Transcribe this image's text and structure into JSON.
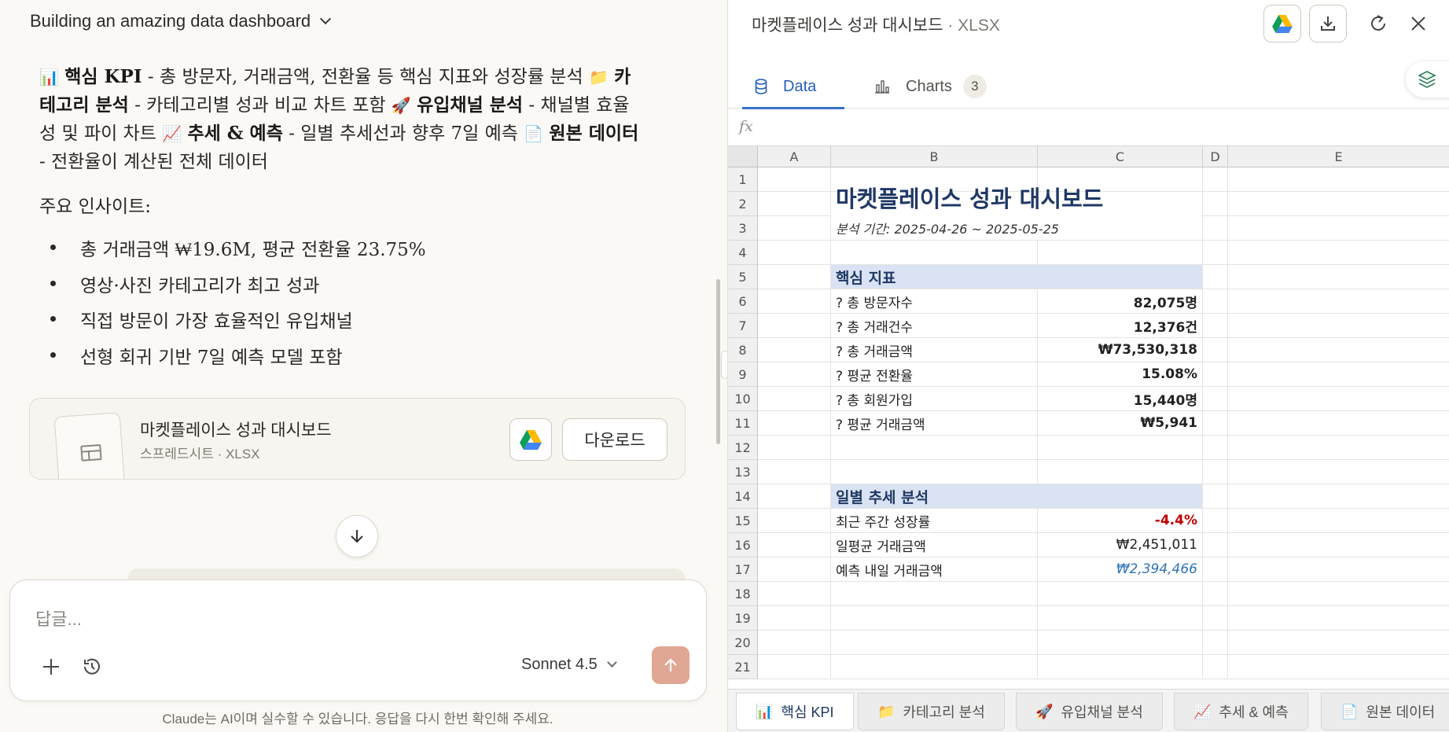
{
  "conversation": {
    "title": "Building an amazing data dashboard"
  },
  "message": {
    "parts": [
      {
        "emoji": "📊",
        "bold": "핵심 KPI",
        "text": " - 총 방문자, 거래금액, 전환율 등 핵심 지표와 성장률 분석 "
      },
      {
        "emoji": "📁",
        "bold": "카테고리 분석",
        "text": " - 카테고리별 성과 비교 차트 포함 "
      },
      {
        "emoji": "🚀",
        "bold": "유입채널 분석",
        "text": " - 채널별 효율성 및 파이 차트 "
      },
      {
        "emoji": "📈",
        "bold": "추세 & 예측",
        "text": " - 일별 추세선과 향후 7일 예측 "
      },
      {
        "emoji": "📄",
        "bold": "원본 데이터",
        "text": " - 전환율이 계산된 전체 데이터"
      }
    ],
    "insights_heading": "주요 인사이트:",
    "insights": [
      "총 거래금액 ₩19.6M, 평균 전환율 23.75%",
      "영상·사진 카테고리가 최고 성과",
      "직접 방문이 가장 효율적인 유입채널",
      "선형 회귀 기반 7일 예측 모델 포함"
    ]
  },
  "artifact": {
    "title": "마켓플레이스 성과 대시보드",
    "subtitle": "스프레드시트 · XLSX",
    "download_label": "다운로드"
  },
  "composer": {
    "placeholder": "답글...",
    "model": "Sonnet 4.5"
  },
  "disclaimer": "Claude는 AI이며 실수할 수 있습니다. 응답을 다시 한번 확인해 주세요.",
  "viewer": {
    "title": "마켓플레이스 성과 대시보드",
    "file_type": " · XLSX",
    "tabs": [
      {
        "label": "Data",
        "icon": "database-icon",
        "active": true
      },
      {
        "label": "Charts",
        "icon": "bar-chart-icon",
        "count": "3",
        "active": false
      }
    ],
    "formula_label": "fx"
  },
  "sheet": {
    "columns": [
      "A",
      "B",
      "C",
      "D",
      "E"
    ],
    "rows": [
      "1",
      "2",
      "3",
      "4",
      "5",
      "6",
      "7",
      "8",
      "9",
      "10",
      "11",
      "12",
      "13",
      "14",
      "15",
      "16",
      "17",
      "18",
      "19",
      "20",
      "21"
    ],
    "title": "마켓플레이스 성과 대시보드",
    "period": "분석 기간: 2025-04-26 ~ 2025-05-25",
    "kpi_section": "핵심 지표",
    "kpis": [
      {
        "label": "? 총 방문자수",
        "value": "82,075명"
      },
      {
        "label": "? 총 거래건수",
        "value": "12,376건"
      },
      {
        "label": "? 총 거래금액",
        "value": "₩73,530,318"
      },
      {
        "label": "? 평균 전환율",
        "value": "15.08%"
      },
      {
        "label": "? 총 회원가입",
        "value": "15,440명"
      },
      {
        "label": "? 평균 거래금액",
        "value": "₩5,941"
      }
    ],
    "trend_section": "일별 추세 분석",
    "trend": [
      {
        "label": "최근 주간 성장률",
        "value": "-4.4%"
      },
      {
        "label": "일평균 거래금액",
        "value": "₩2,451,011"
      },
      {
        "label": "예측 내일 거래금액",
        "value": "₩2,394,466"
      }
    ]
  },
  "sheet_tabs": [
    {
      "emoji": "📊",
      "label": "핵심 KPI",
      "active": true
    },
    {
      "emoji": "📁",
      "label": "카테고리 분석",
      "active": false
    },
    {
      "emoji": "🚀",
      "label": "유입채널 분석",
      "active": false
    },
    {
      "emoji": "📈",
      "label": "추세 & 예측",
      "active": false
    },
    {
      "emoji": "📄",
      "label": "원본 데이터",
      "active": false
    }
  ],
  "colors": {
    "accent": "#2360b8",
    "send_button": "#e0a795",
    "section_fill": "#dae3f3",
    "negative": "#c00000",
    "forecast": "#2e75b6"
  }
}
